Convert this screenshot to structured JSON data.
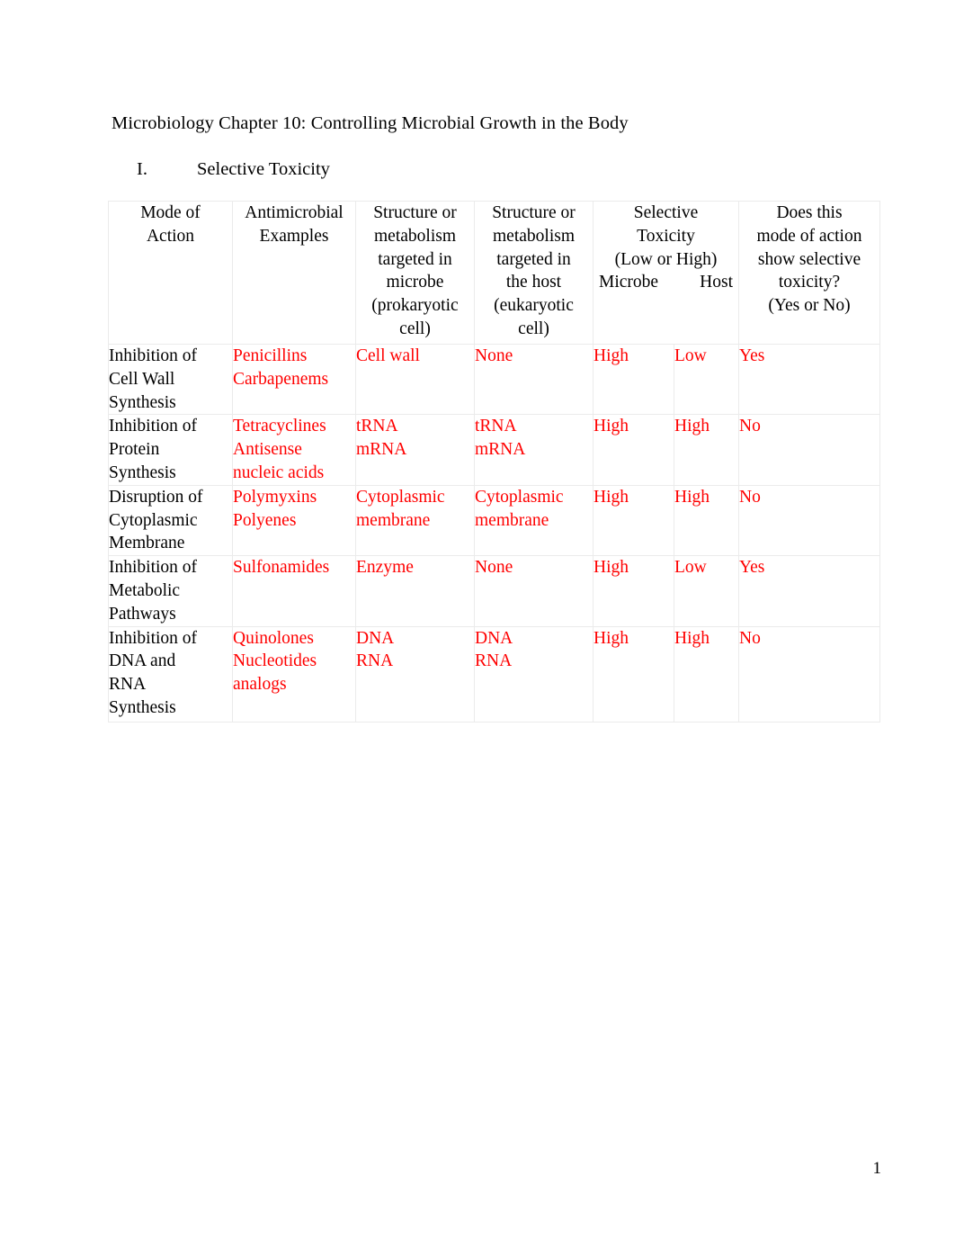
{
  "document": {
    "title": "Microbiology Chapter 10: Controlling Microbial Growth in the Body",
    "page_number": "1",
    "text_color": "#000000",
    "accent_color": "#ff0000",
    "border_color": "#ebebeb"
  },
  "outline": {
    "number": "I.",
    "label": "Selective Toxicity"
  },
  "table": {
    "headers": {
      "mode_of_action": "Mode of\nAction",
      "mode_of_action_lines": [
        "Mode of",
        "Action"
      ],
      "antimicrobial_examples_lines": [
        "Antimicrobial",
        "Examples"
      ],
      "microbe_target_lines": [
        "Structure or",
        "metabolism",
        "targeted in",
        "microbe",
        "(prokaryotic",
        "cell)"
      ],
      "host_target_lines": [
        "Structure or",
        "metabolism",
        "targeted in",
        "the host",
        "(eukaryotic",
        "cell)"
      ],
      "selective_toxicity_lines": [
        "Selective",
        "Toxicity",
        "(Low or High)"
      ],
      "selective_toxicity_sub": [
        "Microbe",
        "Host"
      ],
      "selective_question_lines": [
        "Does this",
        "mode of action",
        "show selective",
        "toxicity?",
        "(Yes or No)"
      ]
    },
    "rows": [
      {
        "mode_of_action": [
          "Inhibition of",
          "Cell Wall",
          "Synthesis"
        ],
        "examples": [
          "Penicillins",
          "Carbapenems"
        ],
        "microbe_target": [
          "Cell wall"
        ],
        "host_target": [
          "None"
        ],
        "toxicity_microbe": "High",
        "toxicity_host": "Low",
        "selective": "Yes"
      },
      {
        "mode_of_action": [
          "Inhibition of",
          "Protein",
          "Synthesis"
        ],
        "examples": [
          "Tetracyclines",
          "Antisense",
          "nucleic acids"
        ],
        "microbe_target": [
          "tRNA",
          "mRNA"
        ],
        "host_target": [
          "tRNA",
          "mRNA"
        ],
        "toxicity_microbe": "High",
        "toxicity_host": "High",
        "selective": "No"
      },
      {
        "mode_of_action": [
          "Disruption of",
          "Cytoplasmic",
          "Membrane"
        ],
        "examples": [
          "Polymyxins",
          "Polyenes"
        ],
        "microbe_target": [
          "Cytoplasmic",
          "membrane"
        ],
        "host_target": [
          "Cytoplasmic",
          "membrane"
        ],
        "toxicity_microbe": "High",
        "toxicity_host": "High",
        "selective": "No"
      },
      {
        "mode_of_action": [
          "Inhibition of",
          "Metabolic",
          "Pathways"
        ],
        "examples": [
          "Sulfonamides"
        ],
        "microbe_target": [
          "Enzyme"
        ],
        "host_target": [
          "None"
        ],
        "toxicity_microbe": "High",
        "toxicity_host": "Low",
        "selective": "Yes"
      },
      {
        "mode_of_action": [
          "Inhibition of",
          "DNA and",
          "RNA",
          "Synthesis"
        ],
        "examples": [
          "Quinolones",
          "Nucleotides",
          "analogs"
        ],
        "microbe_target": [
          "DNA",
          "RNA"
        ],
        "host_target": [
          "DNA",
          "RNA"
        ],
        "toxicity_microbe": "High",
        "toxicity_host": "High",
        "selective": "No"
      }
    ]
  }
}
